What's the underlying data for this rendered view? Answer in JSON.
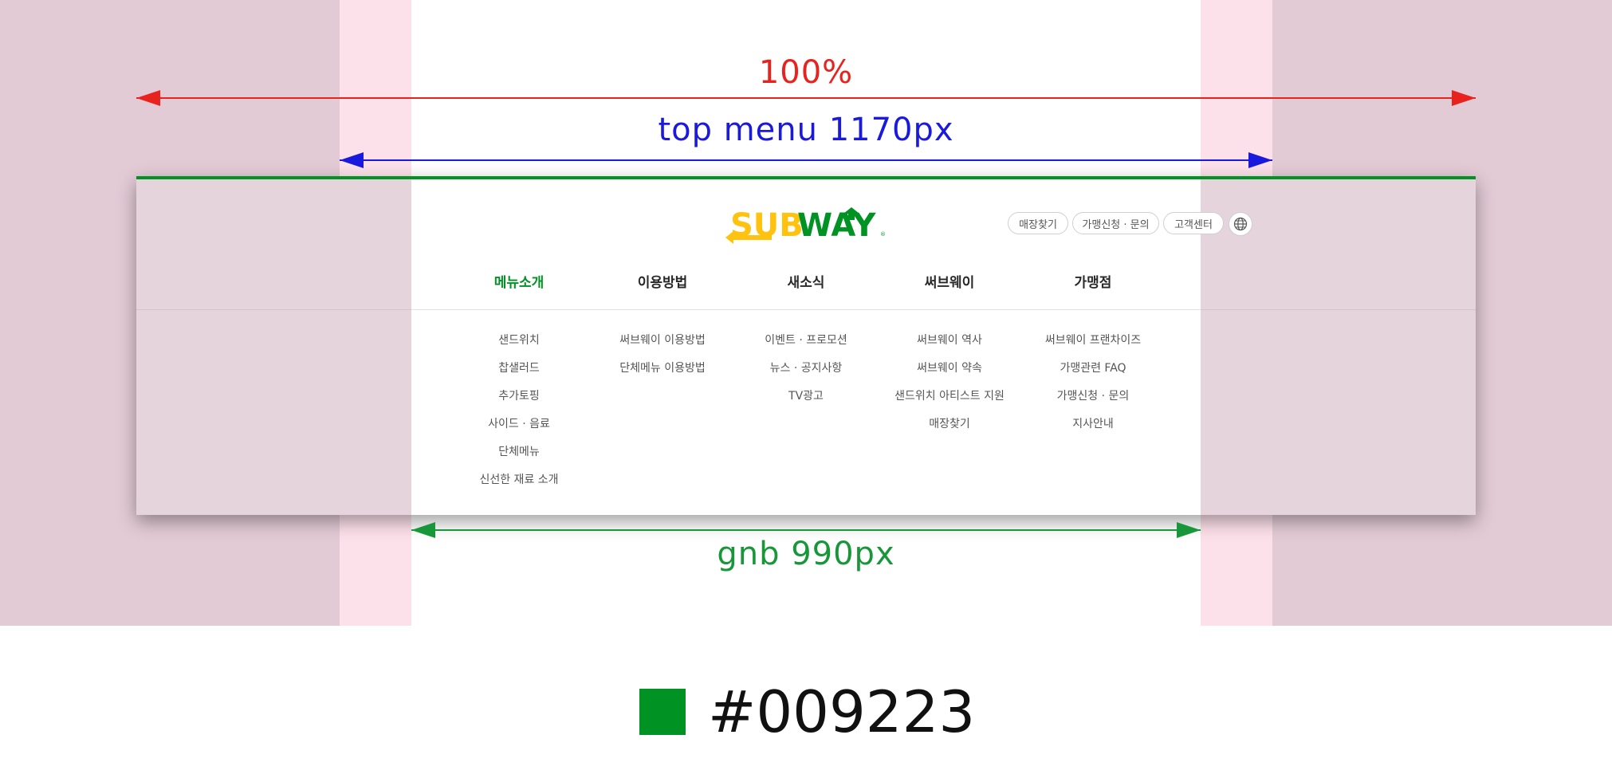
{
  "colors": {
    "brand_green": "#009223",
    "subway_yellow": "#ffc20e",
    "dim_red": "#e8231e",
    "dim_blue": "#1a1adf",
    "dim_green": "#17973a"
  },
  "dimensions": {
    "full_width_label": "100%",
    "top_menu_label": "top menu 1170px",
    "gnb_label": "gnb 990px"
  },
  "header": {
    "logo_text": "SUBWAY",
    "util_links": [
      "매장찾기",
      "가맹신청 · 문의",
      "고객센터"
    ],
    "globe_icon": "globe-icon"
  },
  "gnb": {
    "active_index": 0,
    "items": [
      {
        "label": "메뉴소개",
        "sub": [
          "샌드위치",
          "찹샐러드",
          "추가토핑",
          "사이드 · 음료",
          "단체메뉴",
          "신선한 재료 소개"
        ]
      },
      {
        "label": "이용방법",
        "sub": [
          "써브웨이 이용방법",
          "단체메뉴 이용방법"
        ]
      },
      {
        "label": "새소식",
        "sub": [
          "이벤트 · 프로모션",
          "뉴스 · 공지사항",
          "TV광고"
        ]
      },
      {
        "label": "써브웨이",
        "sub": [
          "써브웨이 역사",
          "써브웨이 약속",
          "샌드위치 아티스트 지원",
          "매장찾기"
        ]
      },
      {
        "label": "가맹점",
        "sub": [
          "써브웨이 프랜차이즈",
          "가맹관련 FAQ",
          "가맹신청 · 문의",
          "지사안내"
        ]
      }
    ]
  },
  "swatch": {
    "hex_label": "#009223"
  }
}
